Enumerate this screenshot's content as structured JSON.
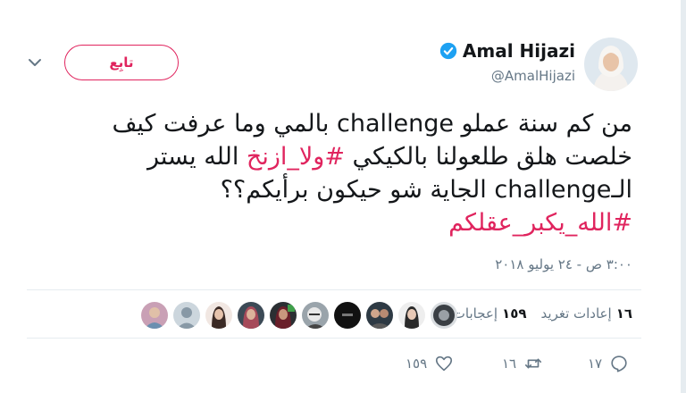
{
  "tweet": {
    "display_name": "Amal Hijazi",
    "handle": "@AmalHijazi",
    "follow_label": "تابِع",
    "text_part1": "من كم سنة عملو challenge بالمي وما عرفت كيف خلصت هلق طلعولنا بالكيكي ",
    "hashtag1": "#ولا_ازنخ",
    "text_part2": " الله يستر الـchallenge الجاية شو حيكون برأيكم؟؟ ",
    "hashtag2": "#الله_يكبر_عقلكم",
    "timestamp": "٣:٠٠ ص - ٢٤ يوليو ٢٠١٨"
  },
  "stats": {
    "retweets_count": "١٦",
    "retweets_label": "إعادات تغريد",
    "likes_count": "١٥٩",
    "likes_label": "إعجابات"
  },
  "actions": {
    "reply_count": "١٧",
    "retweet_count": "١٦",
    "like_count": "١٥٩"
  },
  "colors": {
    "accent": "#e0245e",
    "verified": "#1da1f2",
    "muted": "#657786"
  }
}
